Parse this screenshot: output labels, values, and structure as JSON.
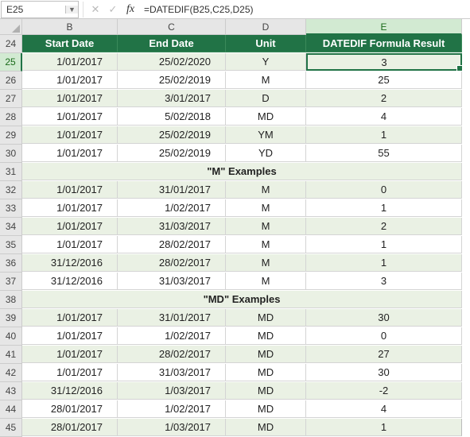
{
  "name_box": "E25",
  "formula": "=DATEDIF(B25,C25,D25)",
  "cols": [
    "B",
    "C",
    "D",
    "E"
  ],
  "head": {
    "b": "Start Date",
    "c": "End Date",
    "d": "Unit",
    "e": "DATEDIF Formula Result"
  },
  "sec1": "\"M\" Examples",
  "sec2": "\"MD\" Examples",
  "rows": [
    {
      "n": "24",
      "h": true
    },
    {
      "n": "25",
      "b": "1/01/2017",
      "c": "25/02/2020",
      "d": "Y",
      "e": "3",
      "s": true,
      "sel": true
    },
    {
      "n": "26",
      "b": "1/01/2017",
      "c": "25/02/2019",
      "d": "M",
      "e": "25"
    },
    {
      "n": "27",
      "b": "1/01/2017",
      "c": "3/01/2017",
      "d": "D",
      "e": "2",
      "s": true
    },
    {
      "n": "28",
      "b": "1/01/2017",
      "c": "5/02/2018",
      "d": "MD",
      "e": "4"
    },
    {
      "n": "29",
      "b": "1/01/2017",
      "c": "25/02/2019",
      "d": "YM",
      "e": "1",
      "s": true
    },
    {
      "n": "30",
      "b": "1/01/2017",
      "c": "25/02/2019",
      "d": "YD",
      "e": "55"
    },
    {
      "n": "31",
      "sec": 1,
      "s": true
    },
    {
      "n": "32",
      "b": "1/01/2017",
      "c": "31/01/2017",
      "d": "M",
      "e": "0",
      "s": true
    },
    {
      "n": "33",
      "b": "1/01/2017",
      "c": "1/02/2017",
      "d": "M",
      "e": "1"
    },
    {
      "n": "34",
      "b": "1/01/2017",
      "c": "31/03/2017",
      "d": "M",
      "e": "2",
      "s": true
    },
    {
      "n": "35",
      "b": "1/01/2017",
      "c": "28/02/2017",
      "d": "M",
      "e": "1"
    },
    {
      "n": "36",
      "b": "31/12/2016",
      "c": "28/02/2017",
      "d": "M",
      "e": "1",
      "s": true
    },
    {
      "n": "37",
      "b": "31/12/2016",
      "c": "31/03/2017",
      "d": "M",
      "e": "3"
    },
    {
      "n": "38",
      "sec": 2,
      "s": true
    },
    {
      "n": "39",
      "b": "1/01/2017",
      "c": "31/01/2017",
      "d": "MD",
      "e": "30",
      "s": true
    },
    {
      "n": "40",
      "b": "1/01/2017",
      "c": "1/02/2017",
      "d": "MD",
      "e": "0"
    },
    {
      "n": "41",
      "b": "1/01/2017",
      "c": "28/02/2017",
      "d": "MD",
      "e": "27",
      "s": true
    },
    {
      "n": "42",
      "b": "1/01/2017",
      "c": "31/03/2017",
      "d": "MD",
      "e": "30"
    },
    {
      "n": "43",
      "b": "31/12/2016",
      "c": "1/03/2017",
      "d": "MD",
      "e": "-2",
      "s": true
    },
    {
      "n": "44",
      "b": "28/01/2017",
      "c": "1/02/2017",
      "d": "MD",
      "e": "4"
    },
    {
      "n": "45",
      "b": "28/01/2017",
      "c": "1/03/2017",
      "d": "MD",
      "e": "1",
      "s": true
    }
  ]
}
